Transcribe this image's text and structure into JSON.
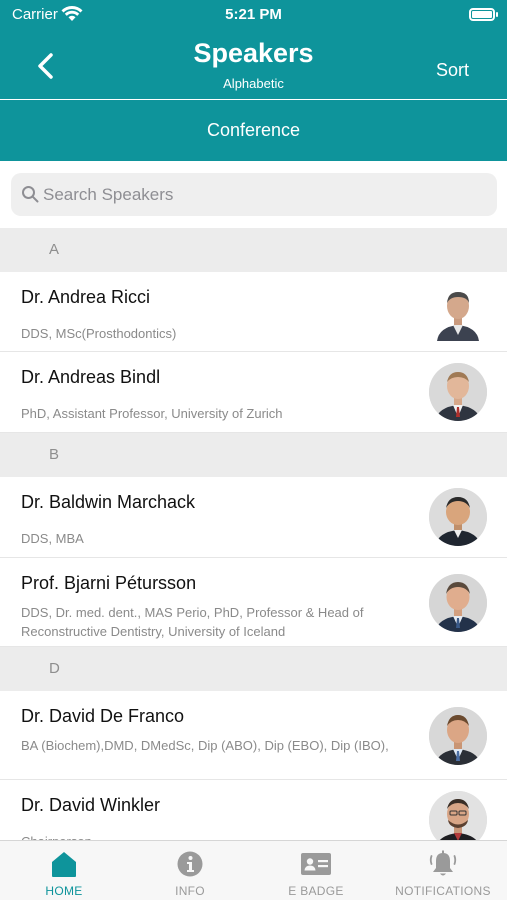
{
  "status_bar": {
    "carrier": "Carrier",
    "time": "5:21 PM"
  },
  "nav": {
    "title": "Speakers",
    "subtitle": "Alphabetic",
    "sort_label": "Sort",
    "back_icon": "chevron-left-icon"
  },
  "subheader": {
    "label": "Conference"
  },
  "search": {
    "placeholder": "Search Speakers",
    "value": ""
  },
  "sections": [
    {
      "letter": "A",
      "speakers": [
        {
          "name": "Dr. Andrea Ricci",
          "credentials": "DDS, MSc(Prosthodontics)"
        },
        {
          "name": "Dr. Andreas Bindl",
          "credentials": "PhD, Assistant Professor, University of Zurich"
        }
      ]
    },
    {
      "letter": "B",
      "speakers": [
        {
          "name": "Dr. Baldwin Marchack",
          "credentials": "DDS, MBA"
        },
        {
          "name": "Prof. Bjarni Pétursson",
          "credentials": "DDS, Dr. med. dent., MAS Perio, PhD, Professor & Head of Reconstructive Dentistry, University of Iceland"
        }
      ]
    },
    {
      "letter": "D",
      "speakers": [
        {
          "name": "Dr. David De Franco",
          "credentials": "BA (Biochem),DMD, DMedSc, Dip (ABO), Dip (EBO), Dip (IBO),"
        },
        {
          "name": "Dr. David Winkler",
          "credentials": "Chairperson"
        }
      ]
    }
  ],
  "tabs": [
    {
      "label": "HOME",
      "icon": "home-icon",
      "active": true
    },
    {
      "label": "INFO",
      "icon": "info-icon",
      "active": false
    },
    {
      "label": "E BADGE",
      "icon": "badge-icon",
      "active": false
    },
    {
      "label": "NOTIFICATIONS",
      "icon": "bell-icon",
      "active": false
    }
  ],
  "colors": {
    "accent": "#0e949b",
    "section_bg": "#ececec",
    "tab_inactive": "#9a9a9a"
  }
}
